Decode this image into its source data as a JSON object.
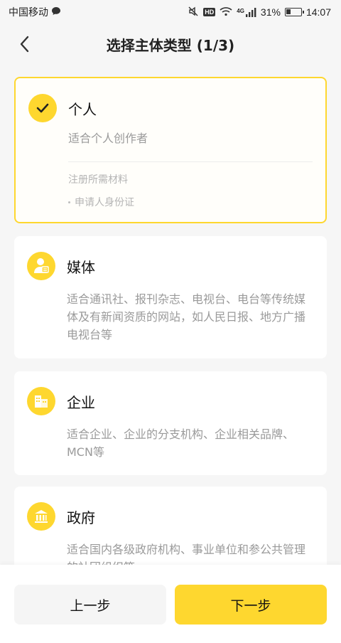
{
  "status_bar": {
    "carrier": "中国移动",
    "signal_label": "4G",
    "battery": "31%",
    "battery_level": 0.31,
    "time": "14:07"
  },
  "header": {
    "title": "选择主体类型 (1/3)"
  },
  "cards": [
    {
      "title": "个人",
      "desc": "适合个人创作者",
      "requirements_title": "注册所需材料",
      "requirements": [
        "申请人身份证"
      ],
      "icon": "check-icon",
      "selected": true
    },
    {
      "title": "媒体",
      "desc": "适合通讯社、报刊杂志、电视台、电台等传统媒体及有新闻资质的网站，如人民日报、地方广播电视台等",
      "icon": "media-icon"
    },
    {
      "title": "企业",
      "desc": "适合企业、企业的分支机构、企业相关品牌、MCN等",
      "icon": "enterprise-icon"
    },
    {
      "title": "政府",
      "desc": "适合国内各级政府机构、事业单位和参公共管理的社团组织等",
      "icon": "government-icon"
    }
  ],
  "buttons": {
    "prev": "上一步",
    "next": "下一步"
  },
  "colors": {
    "accent": "#fed72f",
    "background": "#f6f6f6"
  }
}
